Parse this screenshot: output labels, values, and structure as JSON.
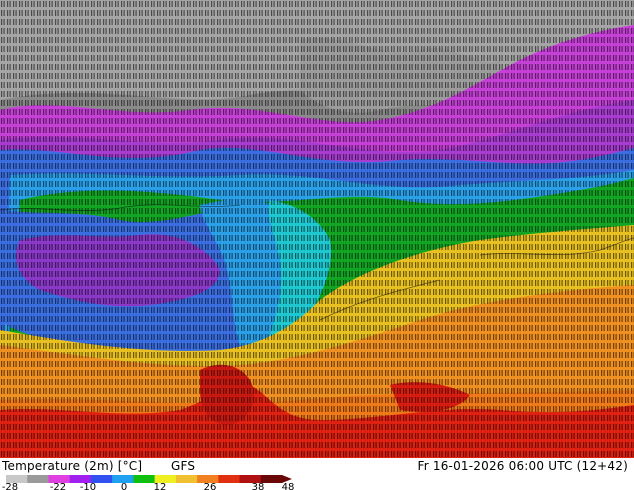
{
  "map": {
    "title": "Temperature (2m) [°C]",
    "model": "GFS",
    "valid_time": "Fr 16-01-2026 06:00 UTC (12+42)",
    "regions": [
      {
        "name": "arctic-gray",
        "color": "#8a8a8a"
      },
      {
        "name": "magenta-band",
        "color": "#c640d8"
      },
      {
        "name": "purple-band",
        "color": "#8a38c8"
      },
      {
        "name": "blue-band",
        "color": "#2f68e0"
      },
      {
        "name": "light-blue-band",
        "color": "#27a8e8"
      },
      {
        "name": "cyan-band",
        "color": "#1ec8d0"
      },
      {
        "name": "green-band",
        "color": "#13a824"
      },
      {
        "name": "yellow-band",
        "color": "#e8c020"
      },
      {
        "name": "orange-band",
        "color": "#f09020"
      },
      {
        "name": "red-band",
        "color": "#e02010"
      }
    ]
  },
  "legend": {
    "ticks": [
      "-28",
      "-22",
      "-10",
      "0",
      "12",
      "26",
      "38",
      "48"
    ],
    "colors": [
      "#c8c8c8",
      "#9a9a9a",
      "#e040e0",
      "#a020f0",
      "#3050f0",
      "#20a0f0",
      "#10c010",
      "#f0f020",
      "#f0c030",
      "#f08020",
      "#e03010",
      "#b01010",
      "#6a0808"
    ]
  }
}
